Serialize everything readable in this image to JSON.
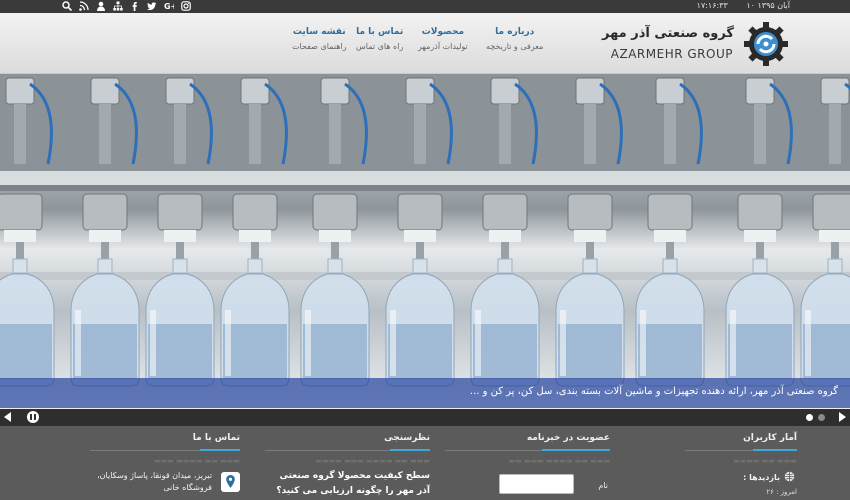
{
  "topbar": {
    "date": "۱۰ آبان ۱۳۹۵",
    "time": "۱۷:۱۶:۳۳",
    "icons": [
      "search-icon",
      "rss-icon",
      "user-icon",
      "sitemap-icon",
      "facebook-icon",
      "twitter-icon",
      "google-plus-icon",
      "instagram-icon"
    ]
  },
  "header": {
    "logo_fa": "گروه صنعتی آذر مهر",
    "logo_en": "AZARMEHR GROUP",
    "nav": [
      {
        "title": "درباره ما",
        "subtitle": "معرفی و تاریخچه"
      },
      {
        "title": "محصولات",
        "subtitle": "تولیدات آذرمهر"
      },
      {
        "title": "تماس با ما",
        "subtitle": "راه های تماس"
      },
      {
        "title": "نقشه سایت",
        "subtitle": "راهنمای صفحات"
      }
    ]
  },
  "slider": {
    "caption": "گروه صنعتی آذر مهر، ارائه دهنده تجهیزات و ماشین آلات بسته بندی، سل کن، پر کن و ..."
  },
  "footer": {
    "stats": {
      "title": "آمار کاربران",
      "visits_label": "بازدیدها :",
      "today": "امروز : ۲۶"
    },
    "newsletter": {
      "title": "عضویت در خبرنامه",
      "name_label": "نام"
    },
    "poll": {
      "title": "نظرسنجی",
      "question": "سطح کیفیت محصولا گروه صنعتی آذر مهر را چگونه ارزیابی می کنید؟"
    },
    "contact": {
      "title": "تماس با ما",
      "address": "تبریز، میدان قونقا، پاساژ وسکایان، فروشگاه خانی"
    }
  },
  "colors": {
    "accent": "#3fa8d8",
    "nav_link": "#2e6f9e",
    "caption_bg": "#2846a0",
    "topbar": "#3a3a3a"
  }
}
